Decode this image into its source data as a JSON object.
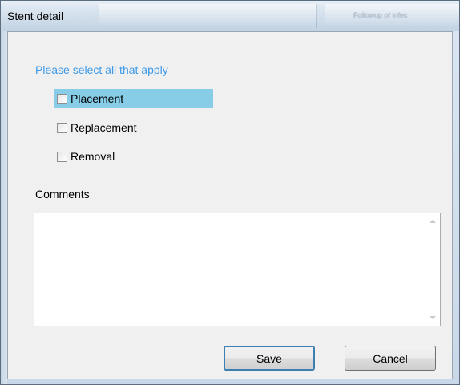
{
  "window": {
    "title": "Stent detail",
    "background_title_text": "Followup of infec"
  },
  "form": {
    "prompt": "Please select all that apply",
    "options": [
      {
        "label": "Placement",
        "checked": false,
        "highlighted": true
      },
      {
        "label": "Replacement",
        "checked": false,
        "highlighted": false
      },
      {
        "label": "Removal",
        "checked": false,
        "highlighted": false
      }
    ],
    "comments": {
      "label": "Comments",
      "value": ""
    }
  },
  "buttons": {
    "save": "Save",
    "cancel": "Cancel"
  },
  "colors": {
    "prompt": "#3c9ae8",
    "highlight": "#87cde8"
  }
}
